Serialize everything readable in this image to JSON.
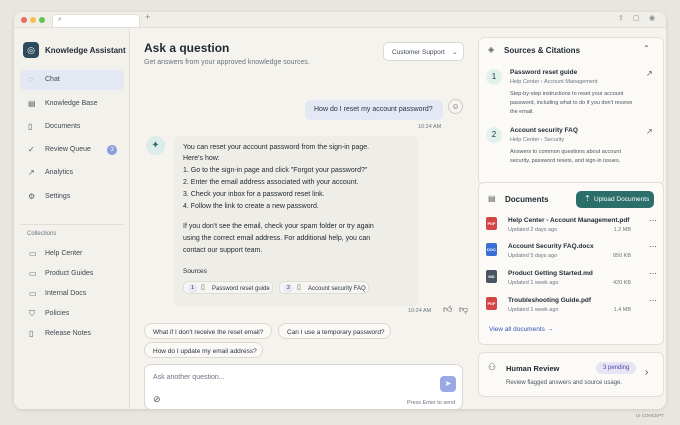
{
  "window": {
    "traffic_lights": [
      "#ec6a5e",
      "#f4bf4f",
      "#61c454"
    ],
    "new_tab_label": "+"
  },
  "app": {
    "name": "Knowledge Assistant"
  },
  "sidebar": {
    "items": [
      {
        "label": "Chat",
        "icon": "chat-icon",
        "active": true
      },
      {
        "label": "Knowledge Base",
        "icon": "book-icon"
      },
      {
        "label": "Documents",
        "icon": "document-icon"
      },
      {
        "label": "Review Queue",
        "icon": "check-circle-icon",
        "badge": "3"
      },
      {
        "label": "Analytics",
        "icon": "chart-icon"
      },
      {
        "label": "Settings",
        "icon": "gear-icon"
      }
    ],
    "collections_title": "Collections",
    "collections": [
      {
        "label": "Help Center",
        "icon": "folder-icon"
      },
      {
        "label": "Product Guides",
        "icon": "folder-icon"
      },
      {
        "label": "Internal Docs",
        "icon": "folder-icon"
      },
      {
        "label": "Policies",
        "icon": "shield-icon"
      },
      {
        "label": "Release Notes",
        "icon": "document-icon"
      }
    ]
  },
  "main": {
    "title": "Ask a question",
    "subtitle": "Get answers from your approved knowledge sources.",
    "scope_select": "Customer Support",
    "user_message": "How do I reset my account password?",
    "user_time": "10:24 AM",
    "bot": {
      "intro": "You can reset your account password from the sign-in page.",
      "heres_how": "Here's how:",
      "steps": [
        "1.  Go to the sign-in page and click \"Forgot your password?\"",
        "2.  Enter the email address associated with your account.",
        "3.  Check your inbox for a password reset link.",
        "4.  Follow the link to create a new password."
      ],
      "followup": [
        "If you don't see the email, check your spam folder or try again",
        "using the correct email address. For additional help, you can",
        "contact our support team."
      ],
      "sources_label": "Sources",
      "sources": [
        {
          "num": "1",
          "title": "Password reset guide"
        },
        {
          "num": "2",
          "title": "Account security FAQ"
        }
      ],
      "time": "10:24 AM"
    },
    "suggestions": [
      "What if I don't receive the reset email?",
      "Can I use a temporary password?",
      "How do I update my email address?"
    ],
    "input": {
      "placeholder": "Ask another question...",
      "hint": "Press Enter to send"
    }
  },
  "citations": {
    "title": "Sources & Citations",
    "items": [
      {
        "num": "1",
        "title": "Password reset guide",
        "path": [
          "Help Center",
          "Account Management"
        ],
        "desc": [
          "Step-by-step instructions to reset your account",
          "password, including what to do if you don't receive",
          "the email."
        ]
      },
      {
        "num": "2",
        "title": "Account security FAQ",
        "path": [
          "Help Center",
          "Security"
        ],
        "desc": [
          "Answers to common questions about account",
          "security, password resets, and sign-in issues."
        ]
      }
    ]
  },
  "documents": {
    "title": "Documents",
    "upload_label": "Upload Documents",
    "files": [
      {
        "name": "Help Center - Account Management.pdf",
        "updated": "Updated 2 days ago",
        "size": "1.2 MB",
        "type": "PDF",
        "color": "#d64545"
      },
      {
        "name": "Account Security FAQ.docx",
        "updated": "Updated 5 days ago",
        "size": "850 KB",
        "type": "DOC",
        "color": "#3b6fd4"
      },
      {
        "name": "Product Getting Started.md",
        "updated": "Updated 1 week ago",
        "size": "420 KB",
        "type": "MD",
        "color": "#4a5563"
      },
      {
        "name": "Troubleshooting Guide.pdf",
        "updated": "Updated 1 week ago",
        "size": "1.4 MB",
        "type": "PDF",
        "color": "#d64545"
      }
    ],
    "view_all": "View all documents"
  },
  "review": {
    "title": "Human Review",
    "badge": "3 pending",
    "desc": "Review flagged answers and source usage."
  },
  "corner_label": "UI CONCEPT"
}
